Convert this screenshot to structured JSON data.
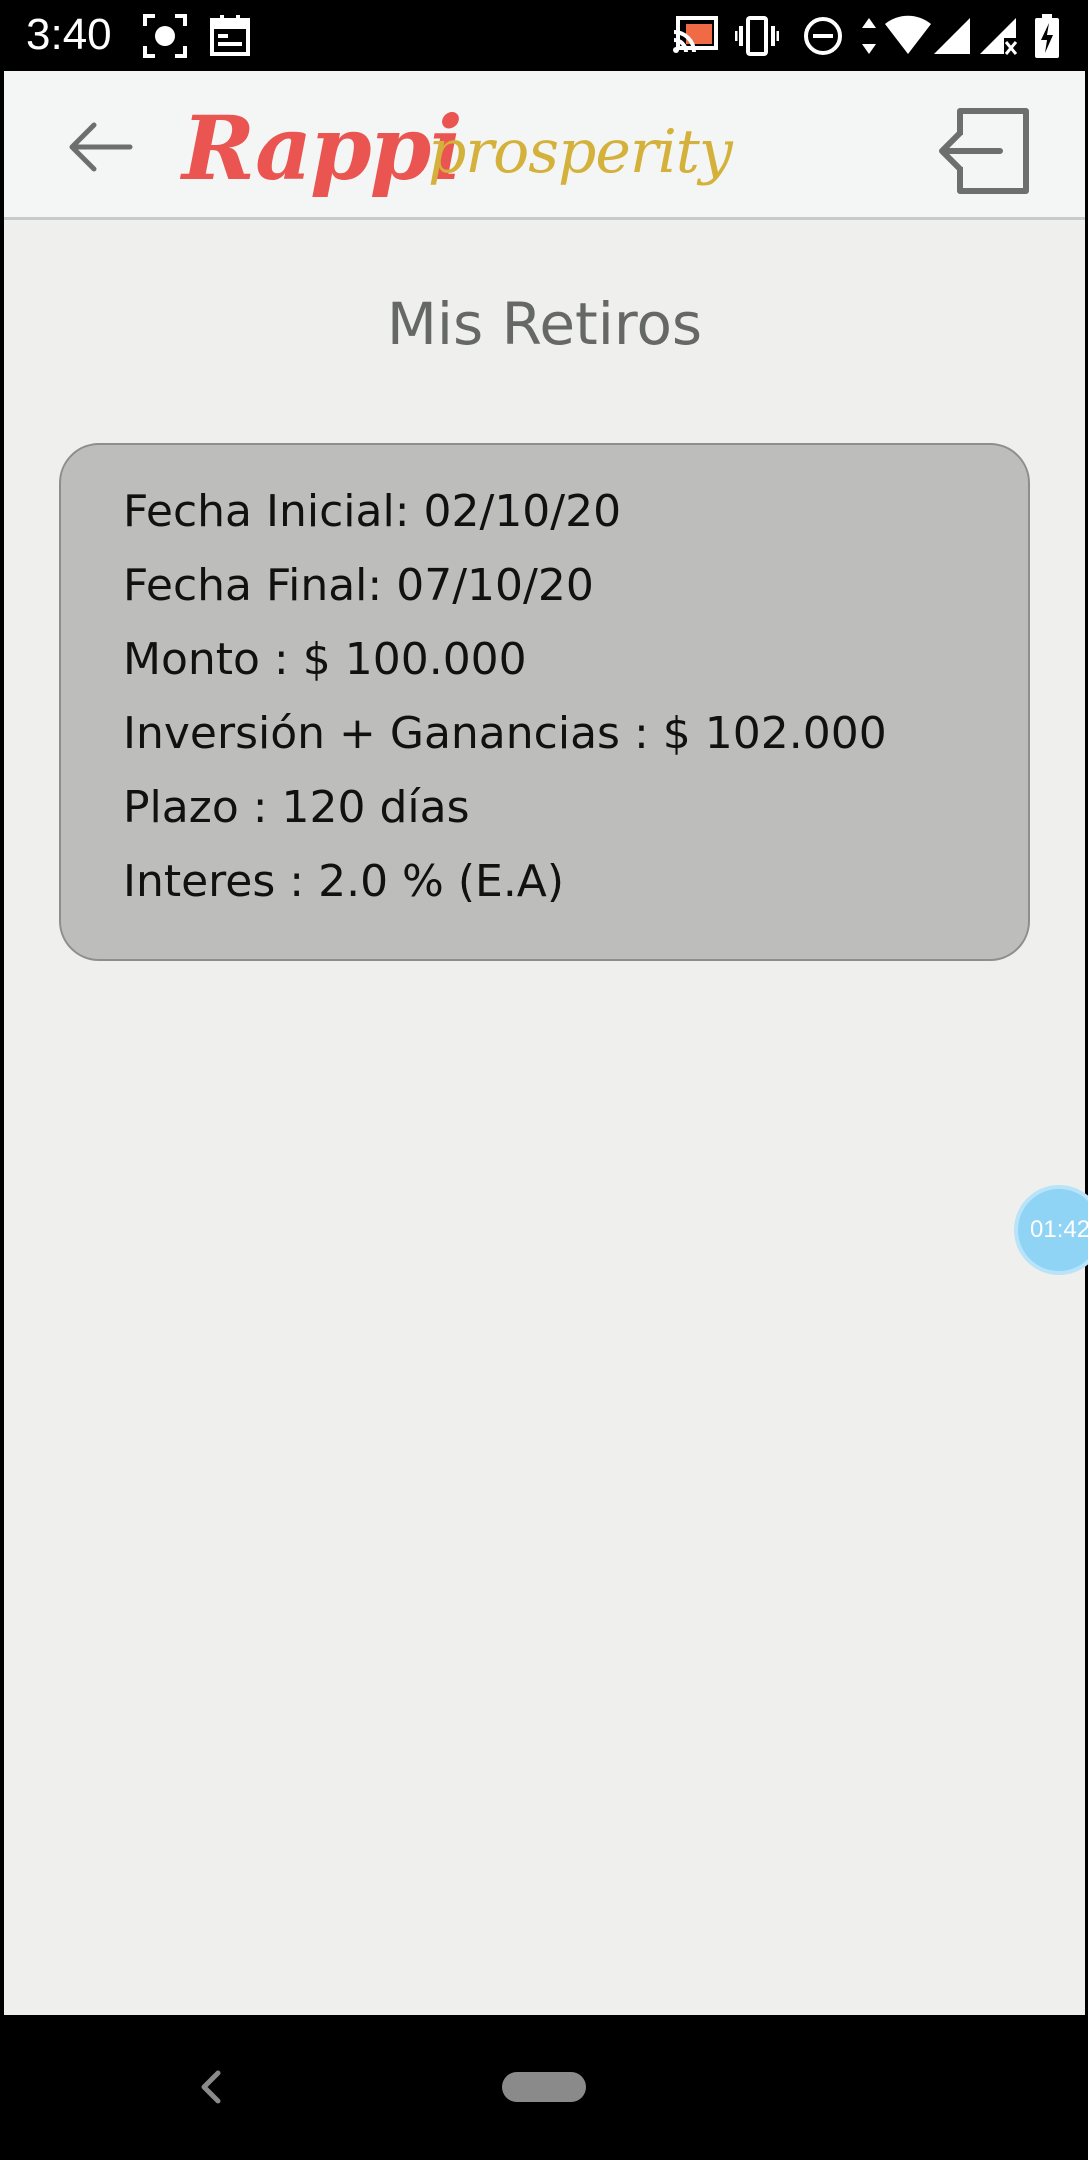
{
  "status_bar": {
    "time": "3:40",
    "icons": [
      "screenshot-icon",
      "calendar-icon",
      "cast-icon",
      "vibrate-icon",
      "do-not-disturb-icon",
      "data-arrows-icon",
      "wifi-icon",
      "signal-icon",
      "no-signal-icon",
      "battery-charging-icon"
    ]
  },
  "header": {
    "back_icon": "arrow-left-icon",
    "logo_primary": "Rappi",
    "logo_secondary": "prosperity",
    "logout_icon": "logout-icon"
  },
  "page": {
    "title": "Mis Retiros"
  },
  "withdrawal": {
    "start_date": "Fecha Inicial: 02/10/20",
    "end_date": "Fecha Final: 07/10/20",
    "amount": "Monto : $ 100.000",
    "investment_plus_gains": "Inversión + Ganancias : $ 102.000",
    "term": "Plazo : 120 días",
    "interest": "Interes : 2.0 % (E.A)"
  },
  "timer": {
    "label": "01:42"
  },
  "colors": {
    "brand_red": "#ea5551",
    "brand_gold": "#d4b13a",
    "card_bg": "#bdbebb",
    "page_bg": "#eff0ee",
    "timer_bg": "#8fd3f5"
  }
}
